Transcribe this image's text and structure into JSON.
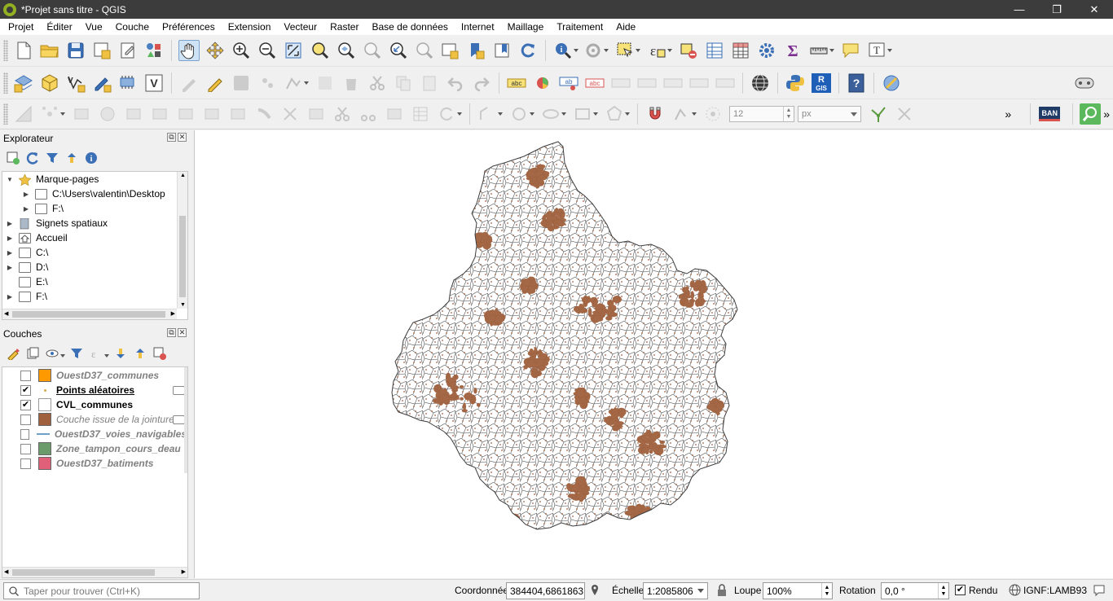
{
  "window": {
    "title": "*Projet sans titre - QGIS",
    "controls": [
      "—",
      "❐",
      "✕"
    ]
  },
  "menu": [
    "Projet",
    "Éditer",
    "Vue",
    "Couche",
    "Préférences",
    "Extension",
    "Vecteur",
    "Raster",
    "Base de données",
    "Internet",
    "Maillage",
    "Traitement",
    "Aide"
  ],
  "toolbar3": {
    "snap_tolerance": "12",
    "snap_unit": "px",
    "more": "»",
    "ban_label": "BAN"
  },
  "explorer": {
    "title": "Explorateur",
    "items": [
      {
        "label": "Marque-pages",
        "icon": "star-icon",
        "expanded": true
      },
      {
        "label": "C:\\Users\\valentin\\Desktop",
        "icon": "folder-icon"
      },
      {
        "label": "F:\\",
        "icon": "folder-icon"
      },
      {
        "label": "Signets spatiaux",
        "icon": "bookmark-icon"
      },
      {
        "label": "Accueil",
        "icon": "home-icon"
      },
      {
        "label": "C:\\",
        "icon": "folder-icon"
      },
      {
        "label": "D:\\",
        "icon": "folder-icon"
      },
      {
        "label": "E:\\",
        "icon": "folder-icon"
      },
      {
        "label": "F:\\",
        "icon": "folder-icon"
      }
    ]
  },
  "layers_panel": {
    "title": "Couches",
    "layers": [
      {
        "name": "OuestD37_communes",
        "checked": false,
        "color": "#ff9900"
      },
      {
        "name": "Points aléatoires",
        "checked": true,
        "color": "#d9a74a"
      },
      {
        "name": "CVL_communes",
        "checked": true,
        "color": "#ffffff"
      },
      {
        "name": "Couche issue de la jointure",
        "checked": false,
        "color": "#a0603d"
      },
      {
        "name": "OuestD37_voies_navigables",
        "checked": false,
        "color": "#6fa0c8"
      },
      {
        "name": "Zone_tampon_cours_deau",
        "checked": false,
        "color": "#6b9a6b"
      },
      {
        "name": "OuestD37_batiments",
        "checked": false,
        "color": "#e0607a"
      }
    ]
  },
  "statusbar": {
    "search_placeholder": "Taper pour trouver (Ctrl+K)",
    "coordinate_label": "Coordonnée",
    "coordinate_value": "384404,6861863",
    "scale_label": "Échelle",
    "scale_value": "1:2085806",
    "magnifier_label": "Loupe",
    "magnifier_value": "100%",
    "rotation_label": "Rotation",
    "rotation_value": "0,0 °",
    "render_label": "Rendu",
    "render_checked": true,
    "crs_value": "IGNF:LAMB93"
  },
  "colors": {
    "map_fill": "#a0603d",
    "map_outline": "#3d3d3d",
    "titlebar": "#3c3c3c",
    "selection": "#cfe3f7"
  }
}
